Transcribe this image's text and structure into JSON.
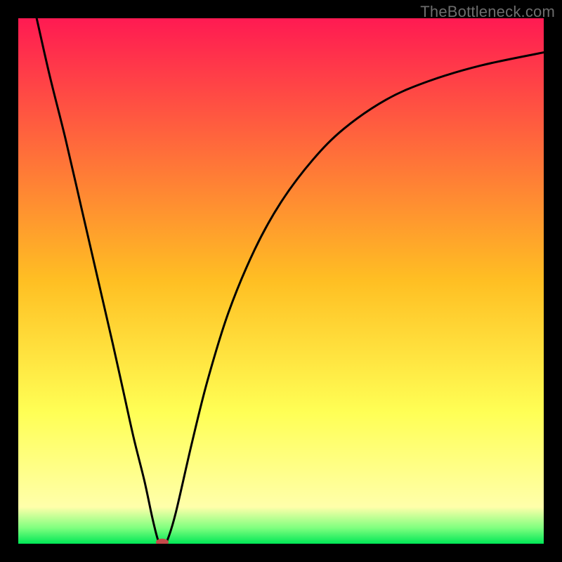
{
  "watermark": "TheBottleneck.com",
  "chart_data": {
    "type": "line",
    "title": "",
    "xlabel": "",
    "ylabel": "",
    "xlim": [
      0,
      100
    ],
    "ylim": [
      0,
      100
    ],
    "grid": false,
    "legend": false,
    "background_gradient": {
      "stops": [
        {
          "offset": 0.0,
          "color": "#ff1a52"
        },
        {
          "offset": 0.5,
          "color": "#ffbf23"
        },
        {
          "offset": 0.75,
          "color": "#ffff55"
        },
        {
          "offset": 0.93,
          "color": "#ffffaa"
        },
        {
          "offset": 0.97,
          "color": "#7fff7f"
        },
        {
          "offset": 1.0,
          "color": "#00e756"
        }
      ]
    },
    "series": [
      {
        "name": "curve",
        "style": "black-line",
        "points": [
          {
            "x": 3.5,
            "y": 100.0
          },
          {
            "x": 6.0,
            "y": 89.0
          },
          {
            "x": 9.0,
            "y": 77.0
          },
          {
            "x": 12.0,
            "y": 64.0
          },
          {
            "x": 15.0,
            "y": 51.0
          },
          {
            "x": 18.0,
            "y": 38.0
          },
          {
            "x": 20.0,
            "y": 29.0
          },
          {
            "x": 22.0,
            "y": 20.0
          },
          {
            "x": 24.0,
            "y": 12.0
          },
          {
            "x": 25.5,
            "y": 5.0
          },
          {
            "x": 26.5,
            "y": 1.0
          },
          {
            "x": 27.0,
            "y": 0.2
          },
          {
            "x": 27.8,
            "y": 0.2
          },
          {
            "x": 28.5,
            "y": 1.0
          },
          {
            "x": 30.0,
            "y": 6.0
          },
          {
            "x": 33.0,
            "y": 19.0
          },
          {
            "x": 36.0,
            "y": 31.0
          },
          {
            "x": 40.0,
            "y": 44.0
          },
          {
            "x": 45.0,
            "y": 56.0
          },
          {
            "x": 50.0,
            "y": 65.0
          },
          {
            "x": 56.0,
            "y": 73.0
          },
          {
            "x": 62.0,
            "y": 79.0
          },
          {
            "x": 70.0,
            "y": 84.5
          },
          {
            "x": 78.0,
            "y": 88.0
          },
          {
            "x": 88.0,
            "y": 91.0
          },
          {
            "x": 100.0,
            "y": 93.5
          }
        ]
      }
    ],
    "marker": {
      "name": "min-point",
      "x": 27.4,
      "y": 0.3,
      "fill": "#c44a4a",
      "rx": 9,
      "ry": 5
    }
  }
}
